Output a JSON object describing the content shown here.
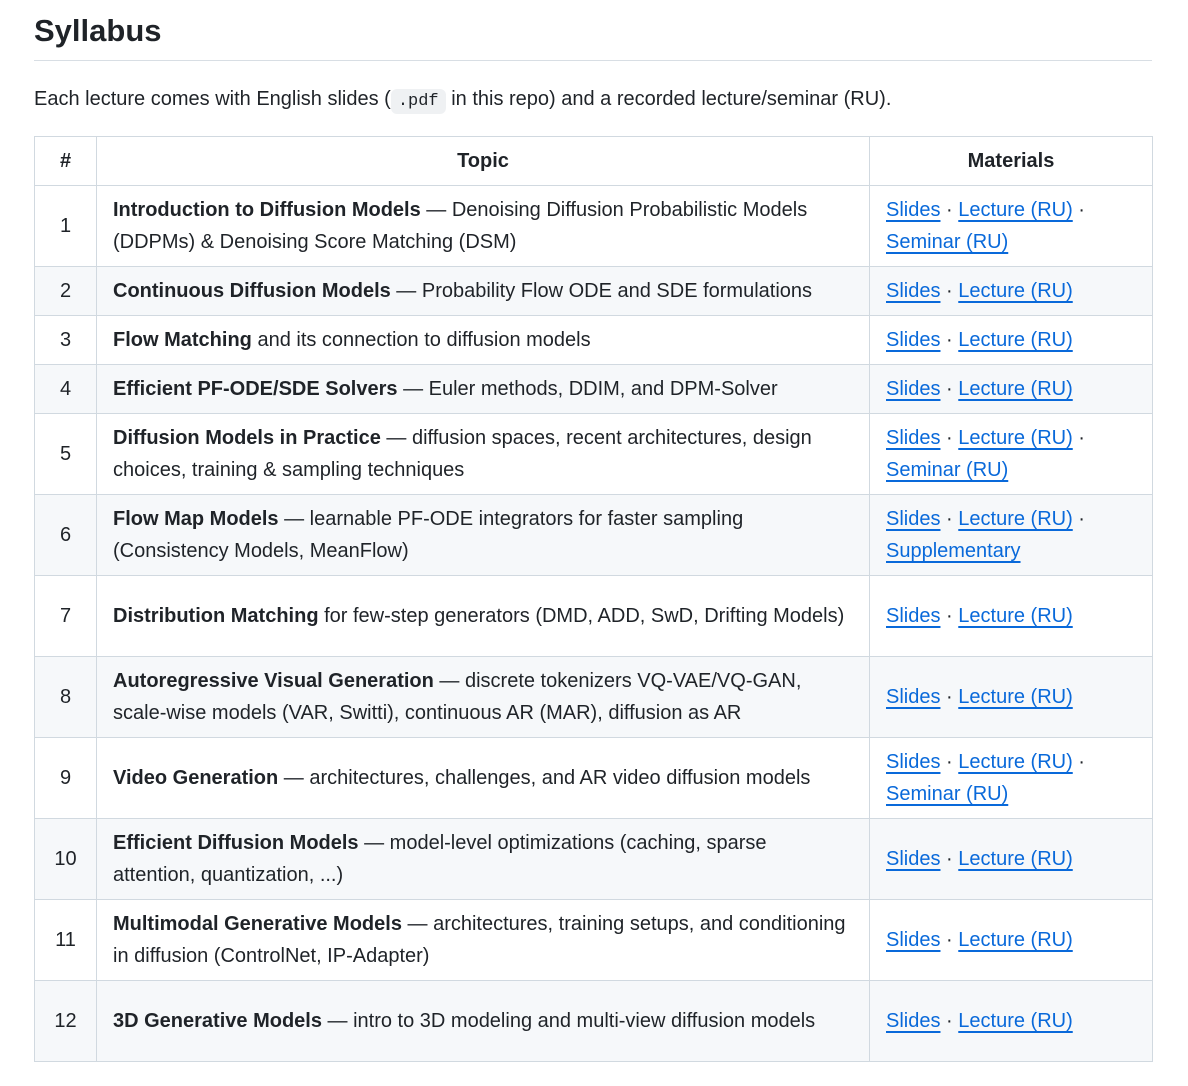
{
  "heading": "Syllabus",
  "intro": {
    "before": "Each lecture comes with English slides (",
    "code": ".pdf",
    "after": " in this repo) and a recorded lecture/seminar (RU)."
  },
  "table": {
    "headers": [
      "#",
      "Topic",
      "Materials"
    ],
    "separator": " · ",
    "rows": [
      {
        "num": "1",
        "title": "Introduction to Diffusion Models",
        "desc": " — Denoising Diffusion Probabilistic Models (DDPMs) & Denoising Score Matching (DSM)",
        "links": [
          "Slides",
          "Lecture (RU)",
          "Seminar (RU)"
        ],
        "lines": 2
      },
      {
        "num": "2",
        "title": "Continuous Diffusion Models",
        "desc": " — Probability Flow ODE and SDE formulations",
        "links": [
          "Slides",
          "Lecture (RU)"
        ],
        "lines": 1
      },
      {
        "num": "3",
        "title": "Flow Matching",
        "desc": " and its connection to diffusion models",
        "links": [
          "Slides",
          "Lecture (RU)"
        ],
        "lines": 1
      },
      {
        "num": "4",
        "title": "Efficient PF-ODE/SDE Solvers",
        "desc": " — Euler methods, DDIM, and DPM-Solver",
        "links": [
          "Slides",
          "Lecture (RU)"
        ],
        "lines": 1
      },
      {
        "num": "5",
        "title": "Diffusion Models in Practice",
        "desc": " — diffusion spaces, recent architectures, design choices, training & sampling techniques",
        "links": [
          "Slides",
          "Lecture (RU)",
          "Seminar (RU)"
        ],
        "lines": 2
      },
      {
        "num": "6",
        "title": "Flow Map Models",
        "desc": " — learnable PF-ODE integrators for faster sampling (Consistency Models, MeanFlow)",
        "links": [
          "Slides",
          "Lecture (RU)",
          "Supplementary"
        ],
        "lines": 2
      },
      {
        "num": "7",
        "title": "Distribution Matching",
        "desc": " for few-step generators (DMD, ADD, SwD, Drifting Models)",
        "links": [
          "Slides",
          "Lecture (RU)"
        ],
        "lines": 2
      },
      {
        "num": "8",
        "title": "Autoregressive Visual Generation",
        "desc": " — discrete tokenizers VQ-VAE/VQ-GAN, scale-wise models (VAR, Switti), continuous AR (MAR), diffusion as AR",
        "links": [
          "Slides",
          "Lecture (RU)"
        ],
        "lines": 2
      },
      {
        "num": "9",
        "title": "Video Generation",
        "desc": " — architectures, challenges, and AR video diffusion models",
        "links": [
          "Slides",
          "Lecture (RU)",
          "Seminar (RU)"
        ],
        "lines": 2
      },
      {
        "num": "10",
        "title": "Efficient Diffusion Models",
        "desc": " — model-level optimizations (caching, sparse attention, quantization, ...)",
        "links": [
          "Slides",
          "Lecture (RU)"
        ],
        "lines": 2
      },
      {
        "num": "11",
        "title": "Multimodal Generative Models",
        "desc": " — architectures, training setups, and conditioning in diffusion (ControlNet, IP-Adapter)",
        "links": [
          "Slides",
          "Lecture (RU)"
        ],
        "lines": 2
      },
      {
        "num": "12",
        "title": "3D Generative Models",
        "desc": " — intro to 3D modeling and multi-view diffusion models",
        "links": [
          "Slides",
          "Lecture (RU)"
        ],
        "lines": 2
      }
    ]
  }
}
